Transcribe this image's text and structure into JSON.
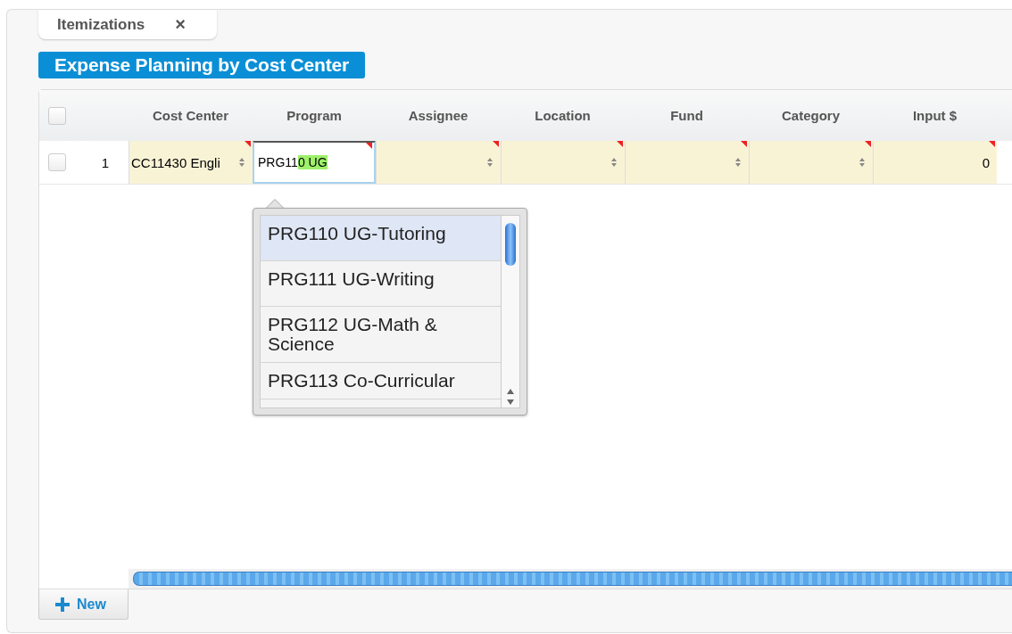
{
  "tabs": [
    {
      "label": "Itemizations",
      "close": "×",
      "selected": true
    }
  ],
  "title": "Expense Planning by Cost Center",
  "grid": {
    "select_all": {
      "checked": false
    },
    "columns": [
      "Cost Center",
      "Program",
      "Assignee",
      "Location",
      "Fund",
      "Category",
      "Input $"
    ],
    "rows": [
      {
        "number": "1",
        "checked": false,
        "cells": [
          {
            "kind": "select",
            "text": "CC11430 Engli",
            "changed": true
          },
          {
            "kind": "editing",
            "typed": "PRG11",
            "suggested": "0 UG",
            "changed": true
          },
          {
            "kind": "select",
            "text": "",
            "changed": true
          },
          {
            "kind": "select",
            "text": "",
            "changed": true
          },
          {
            "kind": "select",
            "text": "",
            "changed": true
          },
          {
            "kind": "select",
            "text": "",
            "changed": true
          },
          {
            "kind": "number",
            "text": "0",
            "changed": true
          }
        ]
      }
    ]
  },
  "dropdown": {
    "items": [
      {
        "label": "PRG110 UG-Tutoring",
        "selected": true
      },
      {
        "label": "PRG111 UG-Writing",
        "selected": false
      },
      {
        "label": "PRG112 UG-Math & Science",
        "selected": false
      },
      {
        "label": "PRG113 Co-Curricular",
        "selected": false
      }
    ]
  },
  "new_button": {
    "label": "New"
  }
}
